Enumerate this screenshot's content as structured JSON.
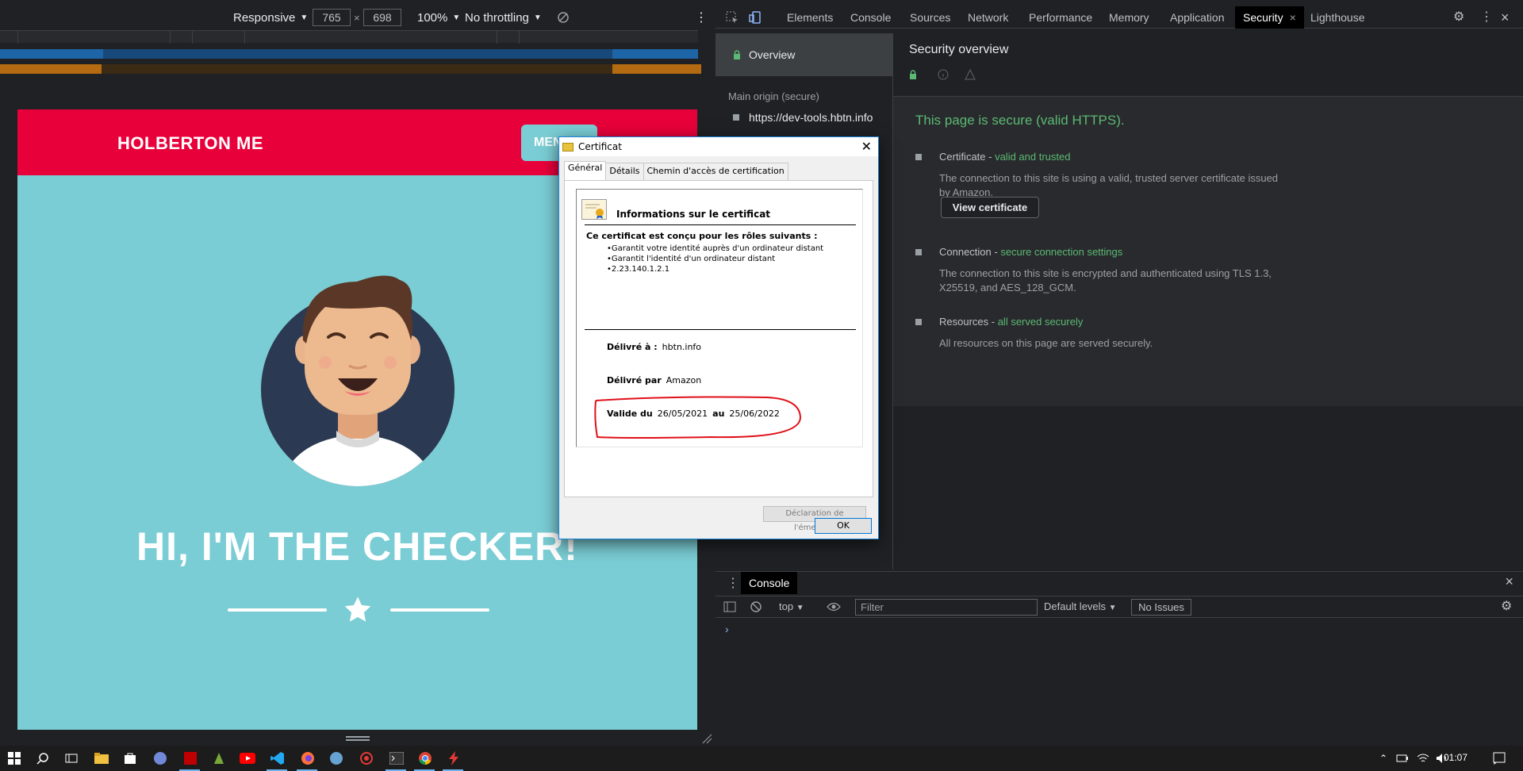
{
  "device_toolbar": {
    "mode": "Responsive",
    "width": "765",
    "times": "×",
    "height": "698",
    "zoom": "100%",
    "throttling": "No throttling"
  },
  "site": {
    "brand": "HOLBERTON ME",
    "menu_label": "MENU",
    "hero_title": "HI, I'M THE CHECKER!"
  },
  "certificate": {
    "window_title": "Certificat",
    "tabs": [
      "Général",
      "Détails",
      "Chemin d'accès de certification"
    ],
    "heading": "Informations sur le certificat",
    "roles_title": "Ce certificat est conçu pour les rôles suivants :",
    "roles": [
      "Garantit votre identité auprès d'un ordinateur distant",
      "Garantit l'identité d'un ordinateur distant",
      "2.23.140.1.2.1"
    ],
    "issued_to_label": "Délivré à :",
    "issued_to": "hbtn.info",
    "issued_by_label": "Délivré par",
    "issued_by": "Amazon",
    "valid_from_label": "Valide du",
    "valid_from": "26/05/2021",
    "valid_to_label": "au",
    "valid_to": "25/06/2022",
    "issuer_statement": "Déclaration de l'émetteur",
    "ok": "OK"
  },
  "devtools": {
    "tabs": [
      "Elements",
      "Console",
      "Sources",
      "Network",
      "Performance",
      "Memory",
      "Application",
      "Security",
      "Lighthouse"
    ],
    "active_tab": "Security",
    "sidebar": {
      "overview": "Overview",
      "main_origin_label": "Main origin (secure)",
      "origin_url": "https://dev-tools.hbtn.info"
    },
    "security": {
      "title": "Security overview",
      "secure_message": "This page is secure (valid HTTPS).",
      "certificate_title": "Certificate - ",
      "certificate_status": "valid and trusted",
      "certificate_desc": "The connection to this site is using a valid, trusted server certificate issued by Amazon.",
      "view_certificate": "View certificate",
      "connection_title": "Connection - ",
      "connection_status": "secure connection settings",
      "connection_desc": "The connection to this site is encrypted and authenticated using TLS 1.3, X25519, and AES_128_GCM.",
      "resources_title": "Resources - ",
      "resources_status": "all served securely",
      "resources_desc": "All resources on this page are served securely."
    },
    "drawer": {
      "tab": "Console",
      "context": "top",
      "filter_placeholder": "Filter",
      "levels": "Default levels",
      "issues": "No Issues",
      "prompt": "›"
    }
  },
  "taskbar": {
    "clock": "01:07"
  },
  "colors": {
    "header_red": "#e8003a",
    "page_teal": "#7acdd4",
    "secure_green": "#5bb974"
  }
}
